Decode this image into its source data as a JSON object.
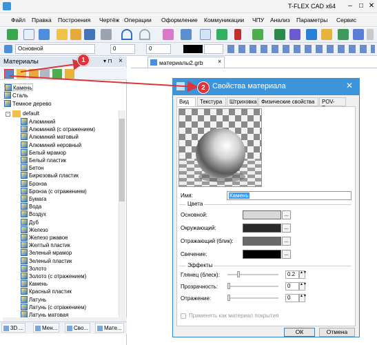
{
  "app": {
    "title": "T-FLEX CAD x64"
  },
  "window_controls": {
    "minimize": "–",
    "maximize": "□",
    "close": "✕"
  },
  "menu": [
    "Файл",
    "Правка",
    "Построения",
    "Чертёж",
    "Операции",
    "Оформление",
    "Коммуникации",
    "ЧПУ",
    "Анализ",
    "Параметры",
    "Сервис"
  ],
  "toolbar2": {
    "layer": "Основной",
    "field1": "0",
    "field2": "0"
  },
  "doc_tab": {
    "label": "материалы2.grb",
    "close": "×"
  },
  "panel": {
    "title": "Материалы",
    "pin": "▾ ⊓",
    "close": "×",
    "libraries": [
      "Камень",
      "Сталь",
      "Темное дерево"
    ],
    "tree_root": "default",
    "materials": [
      "Алюминий",
      "Алюминий (с отражением)",
      "Алюминий матовый",
      "Алюминий неровный",
      "Белый мрамор",
      "Белый пластик",
      "Бетон",
      "Бирюзовый пластик",
      "Бронза",
      "Бронза (с отражением)",
      "Бумага",
      "Вода",
      "Воздух",
      "Дуб",
      "Железо",
      "Железо ржавое",
      "Желтый пластик",
      "Зеленый мрамор",
      "Зеленый пластик",
      "Золото",
      "Золото (с отражением)",
      "Камень",
      "Красный пластик",
      "Латунь",
      "Латунь (с отражением)",
      "Латунь матовая"
    ],
    "bottom_tabs": [
      "3D ...",
      "Мен...",
      "Сво...",
      "Мате..."
    ]
  },
  "badges": {
    "one": "1",
    "two": "2"
  },
  "dialog": {
    "title": "Свойства материала",
    "close": "✕",
    "tabs": [
      "Вид",
      "Текстура",
      "Штриховка",
      "Физические свойства",
      "POV-Ray"
    ],
    "name_label": "Имя:",
    "name_value": "Камень",
    "colors_group": "Цвета",
    "color_rows": [
      {
        "label": "Основной:",
        "color": "#d8d8d8"
      },
      {
        "label": "Окружающий:",
        "color": "#2a2a2a"
      },
      {
        "label": "Отражающий (блик):",
        "color": "#6a6a6a"
      },
      {
        "label": "Свечение:",
        "color": "#000000"
      }
    ],
    "browse": "...",
    "effects_group": "Эффекты",
    "effect_rows": [
      {
        "label": "Глянец (блеск):",
        "value": "0.2",
        "level": 0.2
      },
      {
        "label": "Прозрачность:",
        "value": "0",
        "level": 0
      },
      {
        "label": "Отражение:",
        "value": "0",
        "level": 0
      }
    ],
    "coating_checkbox": "Применять как материал покрытия",
    "ok": "ОК",
    "cancel": "Отмена"
  },
  "colors": {
    "accent": "#3c95da",
    "badge": "#d9353c",
    "arrow": "#d9353c"
  }
}
